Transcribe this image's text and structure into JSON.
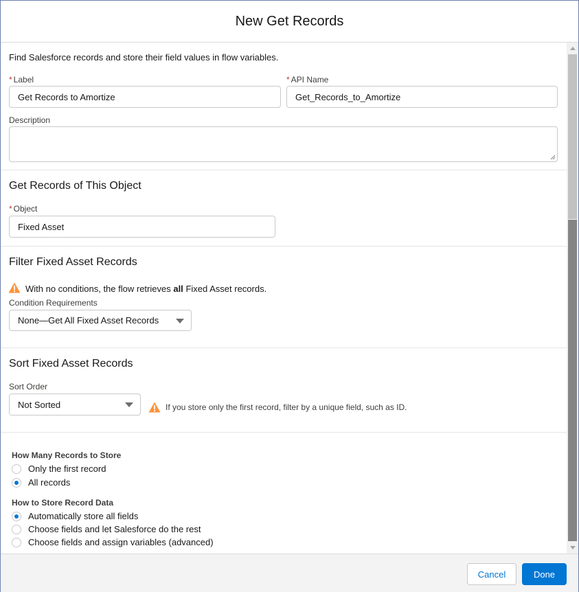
{
  "header": {
    "title": "New Get Records"
  },
  "intro": "Find Salesforce records and store their field values in flow variables.",
  "label_field": {
    "required_mark": "*",
    "label": "Label",
    "value": "Get Records to Amortize"
  },
  "api_name_field": {
    "required_mark": "*",
    "label": "API Name",
    "value": "Get_Records_to_Amortize"
  },
  "description_field": {
    "label": "Description",
    "value": ""
  },
  "object_section": {
    "title": "Get Records of This Object",
    "required_mark": "*",
    "field_label": "Object",
    "value": "Fixed Asset"
  },
  "filter_section": {
    "title": "Filter Fixed Asset Records",
    "warning_before": "With no conditions, the flow retrieves",
    "warning_bold": "all",
    "warning_after": "Fixed Asset records.",
    "condition_label": "Condition Requirements",
    "condition_value": "None—Get All Fixed Asset Records"
  },
  "sort_section": {
    "title": "Sort Fixed Asset Records",
    "sort_label": "Sort Order",
    "sort_value": "Not Sorted",
    "warning": "If you store only the first record, filter by a unique field, such as ID."
  },
  "how_many": {
    "label": "How Many Records to Store",
    "options": [
      {
        "label": "Only the first record",
        "checked": false
      },
      {
        "label": "All records",
        "checked": true
      }
    ]
  },
  "how_store": {
    "label": "How to Store Record Data",
    "options": [
      {
        "label": "Automatically store all fields",
        "checked": true
      },
      {
        "label": "Choose fields and let Salesforce do the rest",
        "checked": false
      },
      {
        "label": "Choose fields and assign variables (advanced)",
        "checked": false
      }
    ]
  },
  "footer": {
    "cancel_label": "Cancel",
    "done_label": "Done"
  },
  "colors": {
    "brand": "#0176d3",
    "required": "#c23934",
    "warning": "#fe9339"
  },
  "icons": {
    "warning": "warning-icon",
    "caret": "chevron-down-icon"
  }
}
